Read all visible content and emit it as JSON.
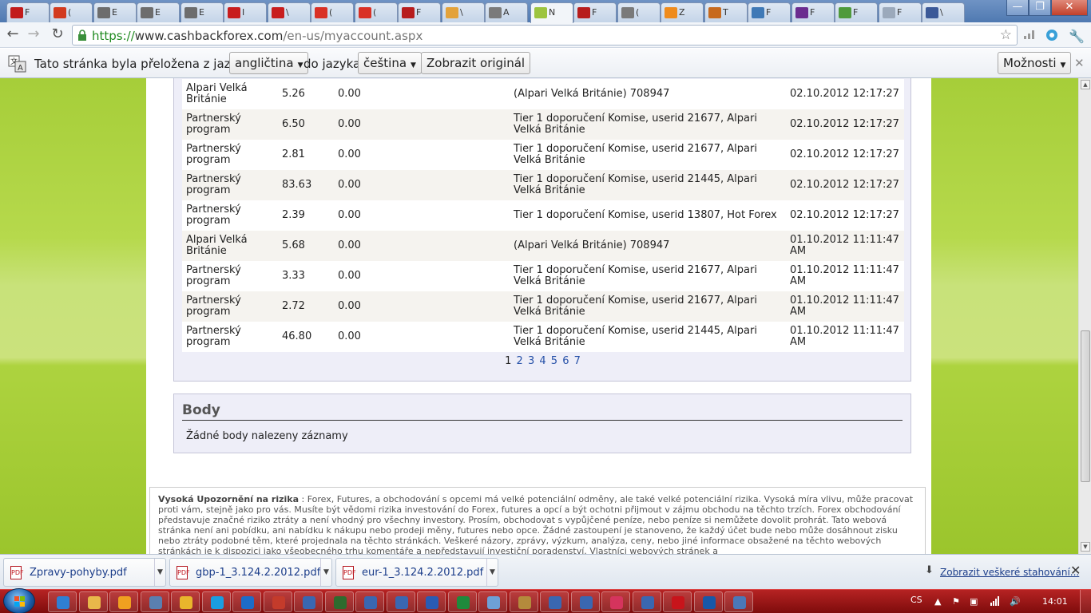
{
  "tabs": [
    {
      "label": "F",
      "color": "#c21b1b"
    },
    {
      "label": "(",
      "color": "#d23a1e"
    },
    {
      "label": "E",
      "color": "#6d6d6d"
    },
    {
      "label": "E",
      "color": "#6d6d6d"
    },
    {
      "label": "E",
      "color": "#6d6d6d"
    },
    {
      "label": "I",
      "color": "#c81d1d"
    },
    {
      "label": "\\",
      "color": "#c81d1d"
    },
    {
      "label": "(",
      "color": "#d93025"
    },
    {
      "label": "(",
      "color": "#d93025"
    },
    {
      "label": "F",
      "color": "#b71c1c"
    },
    {
      "label": "\\",
      "color": "#e3a23a"
    },
    {
      "label": "A",
      "color": "#7a7a7a"
    },
    {
      "label": "N",
      "color": "#9dc43f"
    },
    {
      "label": "F",
      "color": "#b71c1c"
    },
    {
      "label": "(",
      "color": "#7a7a7a"
    },
    {
      "label": "Z",
      "color": "#ef8b1c"
    },
    {
      "label": "T",
      "color": "#c76a1e"
    },
    {
      "label": "F",
      "color": "#3f79b6"
    },
    {
      "label": "F",
      "color": "#6b2c8f"
    },
    {
      "label": "F",
      "color": "#4f9a3b"
    },
    {
      "label": "F",
      "color": "#9ba9bb"
    },
    {
      "label": "\\",
      "color": "#3b5998"
    }
  ],
  "window": {
    "minimize": "—",
    "restore": "❐",
    "close": "✕"
  },
  "toolbar": {
    "back": "←",
    "forward": "→",
    "reload": "↻",
    "url_scheme": "https://",
    "url_host": "www.cashbackforex.com",
    "url_path": "/en-us/myaccount.aspx",
    "star": "☆"
  },
  "translate_bar": {
    "prefix": "Tato stránka byla přeložena z jazyka",
    "from_lang": "angličtina",
    "mid": "do jazyka",
    "to_lang": "čeština",
    "show_original": "Zobrazit originál",
    "options": "Možnosti",
    "close": "✕"
  },
  "transactions": [
    {
      "source": "Alpari Velká Británie",
      "amount": "5.26",
      "paid": "0.00",
      "description": "(Alpari Velká Británie) 708947",
      "date": "02.10.2012 12:17:27"
    },
    {
      "source": "Partnerský program",
      "amount": "6.50",
      "paid": "0.00",
      "description": "Tier 1 doporučení Komise, userid 21677, Alpari Velká Británie",
      "date": "02.10.2012 12:17:27"
    },
    {
      "source": "Partnerský program",
      "amount": "2.81",
      "paid": "0.00",
      "description": "Tier 1 doporučení Komise, userid 21677, Alpari Velká Británie",
      "date": "02.10.2012 12:17:27"
    },
    {
      "source": "Partnerský program",
      "amount": "83.63",
      "paid": "0.00",
      "description": "Tier 1 doporučení Komise, userid 21445, Alpari Velká Británie",
      "date": "02.10.2012 12:17:27"
    },
    {
      "source": "Partnerský program",
      "amount": "2.39",
      "paid": "0.00",
      "description": "Tier 1 doporučení Komise, userid 13807, Hot Forex",
      "date": "02.10.2012 12:17:27"
    },
    {
      "source": "Alpari Velká Británie",
      "amount": "5.68",
      "paid": "0.00",
      "description": "(Alpari Velká Británie) 708947",
      "date": "01.10.2012 11:11:47 AM"
    },
    {
      "source": "Partnerský program",
      "amount": "3.33",
      "paid": "0.00",
      "description": "Tier 1 doporučení Komise, userid 21677, Alpari Velká Británie",
      "date": "01.10.2012 11:11:47 AM"
    },
    {
      "source": "Partnerský program",
      "amount": "2.72",
      "paid": "0.00",
      "description": "Tier 1 doporučení Komise, userid 21677, Alpari Velká Británie",
      "date": "01.10.2012 11:11:47 AM"
    },
    {
      "source": "Partnerský program",
      "amount": "46.80",
      "paid": "0.00",
      "description": "Tier 1 doporučení Komise, userid 21445, Alpari Velká Británie",
      "date": "01.10.2012 11:11:47 AM"
    }
  ],
  "pagination": {
    "current": "1",
    "pages": [
      "2",
      "3",
      "4",
      "5",
      "6",
      "7"
    ]
  },
  "points_section": {
    "title": "Body",
    "empty_message": "Žádné body nalezeny záznamy"
  },
  "risk_warning": {
    "heading": "Vysoká Upozornění na rizika",
    "text": " : Forex, Futures, a obchodování s opcemi má velké potenciální odměny, ale také velké potenciální rizika. Vysoká míra vlivu, může pracovat proti vám, stejně jako pro vás. Musíte být vědomi rizika investování do Forex, futures a opcí a být ochotni přijmout v zájmu obchodu na těchto trzích. Forex obchodování představuje značné riziko ztráty a není vhodný pro všechny investory. Prosím, obchodovat s vypůjčené peníze, nebo peníze si nemůžete dovolit prohrát. Tato webová stránka není ani pobídku, ani nabídku k nákupu nebo prodeji měny, futures nebo opce. Žádné zastoupení je stanoveno, že každý účet bude nebo může dosáhnout zisku nebo ztráty podobné těm, které projednala na těchto stránkách. Veškeré názory, zprávy, výzkum, analýza, ceny, nebo jiné informace obsažené na těchto webových stránkách je k dispozici jako všeobecného trhu komentáře a nepředstavují investiční poradenství. Vlastníci webových stránek a"
  },
  "downloads": [
    {
      "name": "Zpravy-pohyby.pdf"
    },
    {
      "name": "gbp-1_3.124.2.2012.pdf"
    },
    {
      "name": "eur-1_3.124.2.2012.pdf"
    }
  ],
  "downloads_show_all": "Zobrazit veškeré stahování...",
  "taskbar": {
    "apps": [
      {
        "name": "ie",
        "color": "#2f7fd3"
      },
      {
        "name": "explorer",
        "color": "#e8b84a"
      },
      {
        "name": "media-player",
        "color": "#f0a020"
      },
      {
        "name": "remote",
        "color": "#5a7fb0"
      },
      {
        "name": "chrome",
        "color": "#e9b52c"
      },
      {
        "name": "skype",
        "color": "#1a9de0"
      },
      {
        "name": "teamviewer",
        "color": "#1d6cc8"
      },
      {
        "name": "forex",
        "color": "#c43b2b"
      },
      {
        "name": "chart1",
        "color": "#3a67b1"
      },
      {
        "name": "terminal",
        "color": "#2e6b2e"
      },
      {
        "name": "chart2",
        "color": "#3a67b1"
      },
      {
        "name": "chart3",
        "color": "#3a67b1"
      },
      {
        "name": "word",
        "color": "#2a5bb4"
      },
      {
        "name": "excel",
        "color": "#1f8a3c"
      },
      {
        "name": "notepad",
        "color": "#6ea0d6"
      },
      {
        "name": "tool",
        "color": "#b48a3c"
      },
      {
        "name": "chart4",
        "color": "#3a67b1"
      },
      {
        "name": "chart5",
        "color": "#3a67b1"
      },
      {
        "name": "app-a",
        "color": "#d5345d"
      },
      {
        "name": "chart6",
        "color": "#3a67b1"
      },
      {
        "name": "acrobat",
        "color": "#c8141b"
      },
      {
        "name": "app-b",
        "color": "#1858a8"
      },
      {
        "name": "window",
        "color": "#4b78b8"
      }
    ],
    "language": "CS",
    "clock": "14:01"
  }
}
